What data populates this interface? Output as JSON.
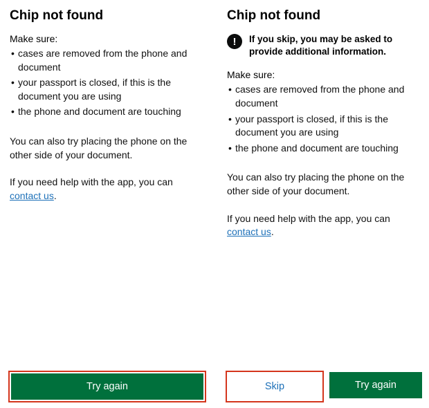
{
  "left": {
    "title": "Chip not found",
    "make_sure": "Make sure:",
    "bullets": [
      "cases are removed from the phone and document",
      "your passport is closed, if this is the document you are using",
      "the phone and document are touching"
    ],
    "other_side": "You can also try placing the phone on the other side of your document.",
    "help_prefix": "If you need help with the app, you can ",
    "help_link": "contact us",
    "help_suffix": ".",
    "try_again": "Try again"
  },
  "right": {
    "title": "Chip not found",
    "warning": "If you skip, you may be asked to provide additional information.",
    "make_sure": "Make sure:",
    "bullets": [
      "cases are removed from the phone and document",
      "your passport is closed, if this is the document you are using",
      "the phone and document are touching"
    ],
    "other_side": "You can also try placing the phone on the other side of your document.",
    "help_prefix": "If you need help with the app, you can ",
    "help_link": "contact us",
    "help_suffix": ".",
    "skip": "Skip",
    "try_again": "Try again"
  }
}
